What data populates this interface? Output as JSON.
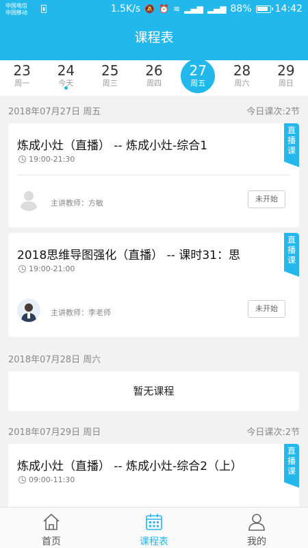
{
  "status_bar": {
    "carrier1": "中国电信",
    "carrier2": "中国移动",
    "speed": "1.5K/s",
    "battery": "88%",
    "time": "14:42"
  },
  "header": {
    "title": "课程表"
  },
  "dates": [
    {
      "num": "23",
      "label": "周一"
    },
    {
      "num": "24",
      "label": "今天"
    },
    {
      "num": "25",
      "label": "周三"
    },
    {
      "num": "26",
      "label": "周四"
    },
    {
      "num": "27",
      "label": "周五"
    },
    {
      "num": "28",
      "label": "周六"
    },
    {
      "num": "29",
      "label": "周日"
    }
  ],
  "groups": [
    {
      "date": "2018年07月27日 周五",
      "count": "今日课次:2节",
      "courses": [
        {
          "title": "炼成小灶（直播） -- 炼成小灶-综合1",
          "time": "19:00-21:30",
          "tag1": "直播",
          "tag2": "课",
          "teacher": "主讲教师：方敏",
          "status": "未开始"
        },
        {
          "title": "2018思维导图强化（直播） -- 课时31：思",
          "time": "19:00-21:00",
          "tag1": "直播",
          "tag2": "课",
          "teacher": "主讲教师：李老师",
          "status": "未开始"
        }
      ]
    },
    {
      "date": "2018年07月28日 周六",
      "empty": "暂无课程"
    },
    {
      "date": "2018年07月29日 周日",
      "count": "今日课次:2节",
      "courses": [
        {
          "title": "炼成小灶（直播） -- 炼成小灶-综合2（上）",
          "time": "09:00-11:30",
          "tag1": "直播",
          "tag2": "课"
        }
      ]
    }
  ],
  "nav": [
    {
      "label": "首页"
    },
    {
      "label": "课程表"
    },
    {
      "label": "我的"
    }
  ],
  "colors": {
    "accent": "#22b8ec"
  }
}
